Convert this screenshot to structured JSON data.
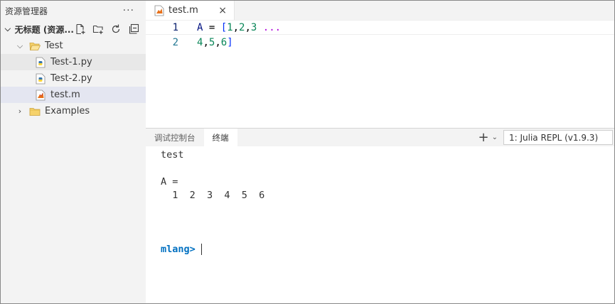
{
  "sidebar": {
    "header_title": "资源管理器",
    "more_label": "···",
    "section_title": "无标题 (资源...",
    "tree": [
      {
        "label": "Test",
        "type": "folder",
        "expanded": true,
        "level": 1
      },
      {
        "label": "Test-1.py",
        "type": "python",
        "level": 2
      },
      {
        "label": "Test-2.py",
        "type": "python",
        "level": 2
      },
      {
        "label": "test.m",
        "type": "matlab",
        "level": 2,
        "selected": true
      },
      {
        "label": "Examples",
        "type": "folder",
        "expanded": false,
        "level": 1
      }
    ]
  },
  "editor": {
    "tab_label": "test.m",
    "close_icon": "×",
    "lines": [
      {
        "number": "1",
        "text": "A = [1,2,3 ..."
      },
      {
        "number": "2",
        "text": "4,5,6]"
      }
    ]
  },
  "panel": {
    "tabs": [
      "调试控制台",
      "终端"
    ],
    "active_tab": "终端",
    "plus_label": "+",
    "chevron_label": "⌄",
    "terminal_select": "1: Julia REPL (v1.9.3)",
    "output": [
      "test",
      "",
      "A =",
      "  1  2  3  4  5  6",
      "",
      "",
      ""
    ],
    "prompt": "mlang>"
  },
  "colors": {
    "sidebar_bg": "#f3f3f3",
    "selected_row": "#e4e6f1",
    "prompt": "#0070c1",
    "line_number": "#237893",
    "number_literal": "#098658"
  }
}
